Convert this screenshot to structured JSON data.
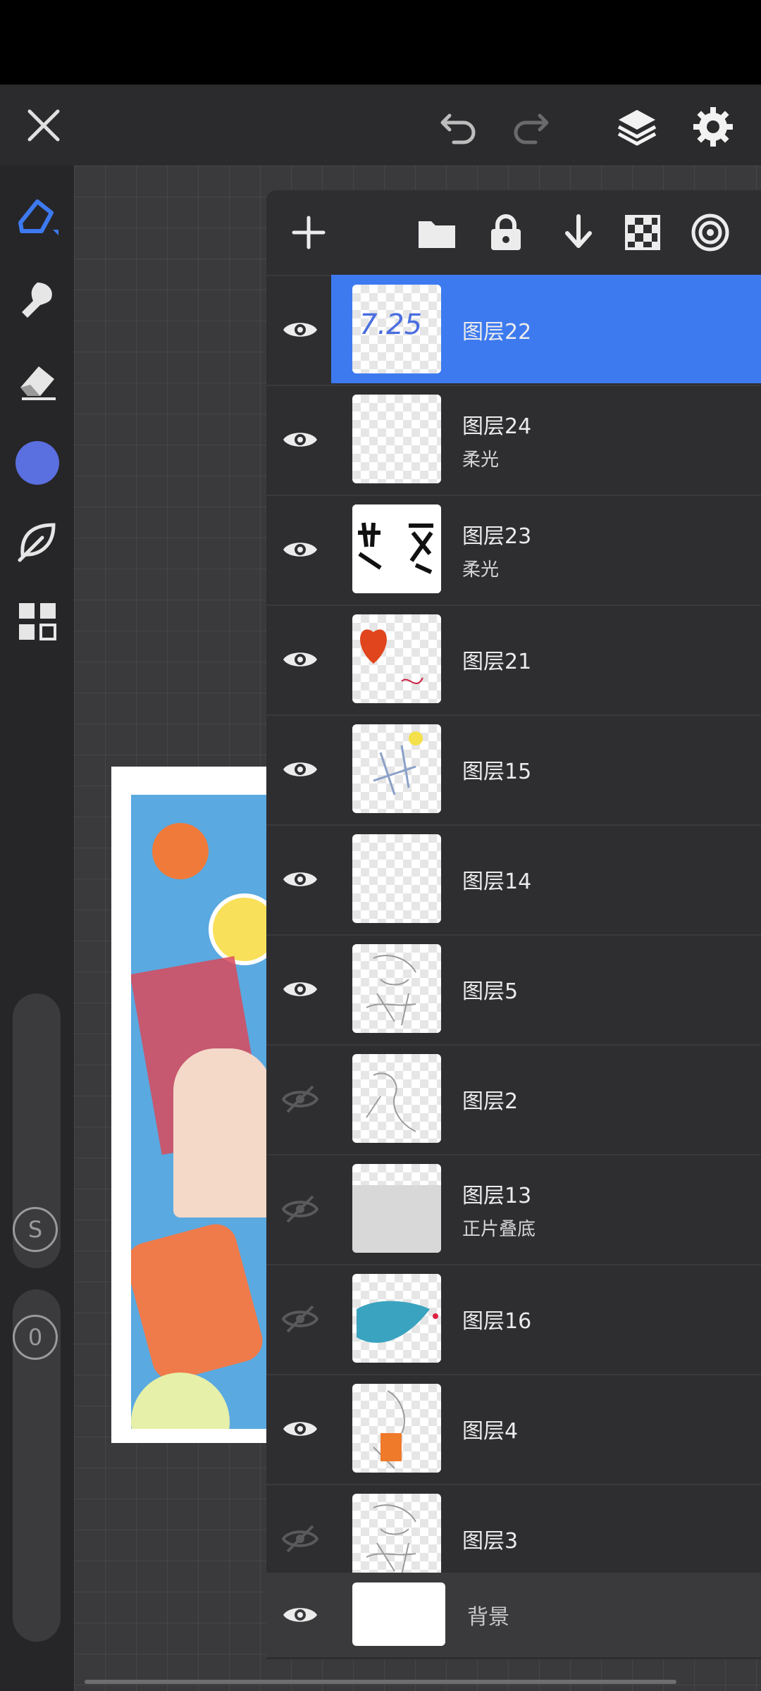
{
  "colors": {
    "accent": "#3d7af0",
    "current_brush_color": "#5a6fe0",
    "panel_bg": "#2e2e31"
  },
  "topbar": {
    "icons": [
      "close-icon",
      "undo-icon",
      "redo-icon",
      "layers-icon",
      "settings-icon"
    ]
  },
  "sidebar": {
    "tools": [
      "brush-icon",
      "smudge-icon",
      "eraser-icon",
      "color-swatch",
      "leaf-icon",
      "grid-icon"
    ],
    "size_button_label": "S",
    "opacity_button_label": "0"
  },
  "layer_panel": {
    "toolbar_icons": [
      "add-icon",
      "folder-icon",
      "lock-icon",
      "merge-down-icon",
      "checker-icon",
      "target-icon"
    ],
    "layers": [
      {
        "name": "图层22",
        "mode": "",
        "visible": true,
        "selected": true,
        "thumb": "text-725"
      },
      {
        "name": "图层24",
        "mode": "柔光",
        "visible": true,
        "selected": false,
        "thumb": "empty"
      },
      {
        "name": "图层23",
        "mode": "柔光",
        "visible": true,
        "selected": false,
        "thumb": "text-hua"
      },
      {
        "name": "图层21",
        "mode": "",
        "visible": true,
        "selected": false,
        "thumb": "heart"
      },
      {
        "name": "图层15",
        "mode": "",
        "visible": true,
        "selected": false,
        "thumb": "sketch-blue"
      },
      {
        "name": "图层14",
        "mode": "",
        "visible": true,
        "selected": false,
        "thumb": "empty"
      },
      {
        "name": "图层5",
        "mode": "",
        "visible": true,
        "selected": false,
        "thumb": "sketch"
      },
      {
        "name": "图层2",
        "mode": "",
        "visible": false,
        "selected": false,
        "thumb": "sketch-hand"
      },
      {
        "name": "图层13",
        "mode": "正片叠底",
        "visible": false,
        "selected": false,
        "thumb": "gray"
      },
      {
        "name": "图层16",
        "mode": "",
        "visible": false,
        "selected": false,
        "thumb": "leaf"
      },
      {
        "name": "图层4",
        "mode": "",
        "visible": true,
        "selected": false,
        "thumb": "sketch-orange"
      },
      {
        "name": "图层3",
        "mode": "",
        "visible": false,
        "selected": false,
        "thumb": "sketch"
      }
    ],
    "background_layer": {
      "name": "背景",
      "visible": true
    }
  }
}
